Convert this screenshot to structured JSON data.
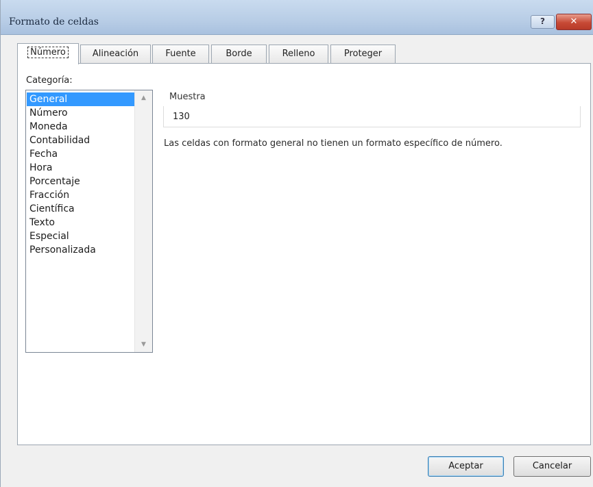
{
  "window": {
    "title": "Formato de celdas",
    "help_label": "?",
    "close_label": "✕"
  },
  "tabs": [
    {
      "label": "Número",
      "active": true
    },
    {
      "label": "Alineación",
      "active": false
    },
    {
      "label": "Fuente",
      "active": false
    },
    {
      "label": "Borde",
      "active": false
    },
    {
      "label": "Relleno",
      "active": false
    },
    {
      "label": "Proteger",
      "active": false
    }
  ],
  "category": {
    "label": "Categoría:",
    "items": [
      "General",
      "Número",
      "Moneda",
      "Contabilidad",
      "Fecha",
      "Hora",
      "Porcentaje",
      "Fracción",
      "Científica",
      "Texto",
      "Especial",
      "Personalizada"
    ],
    "selected": "General"
  },
  "sample": {
    "label": "Muestra",
    "value": "130"
  },
  "description": "Las celdas con formato general no tienen un formato específico de número.",
  "buttons": {
    "ok": "Aceptar",
    "cancel": "Cancelar"
  },
  "colors": {
    "selection": "#3399ff",
    "close_button": "#c74a36",
    "titlebar": "#b8cde6"
  }
}
